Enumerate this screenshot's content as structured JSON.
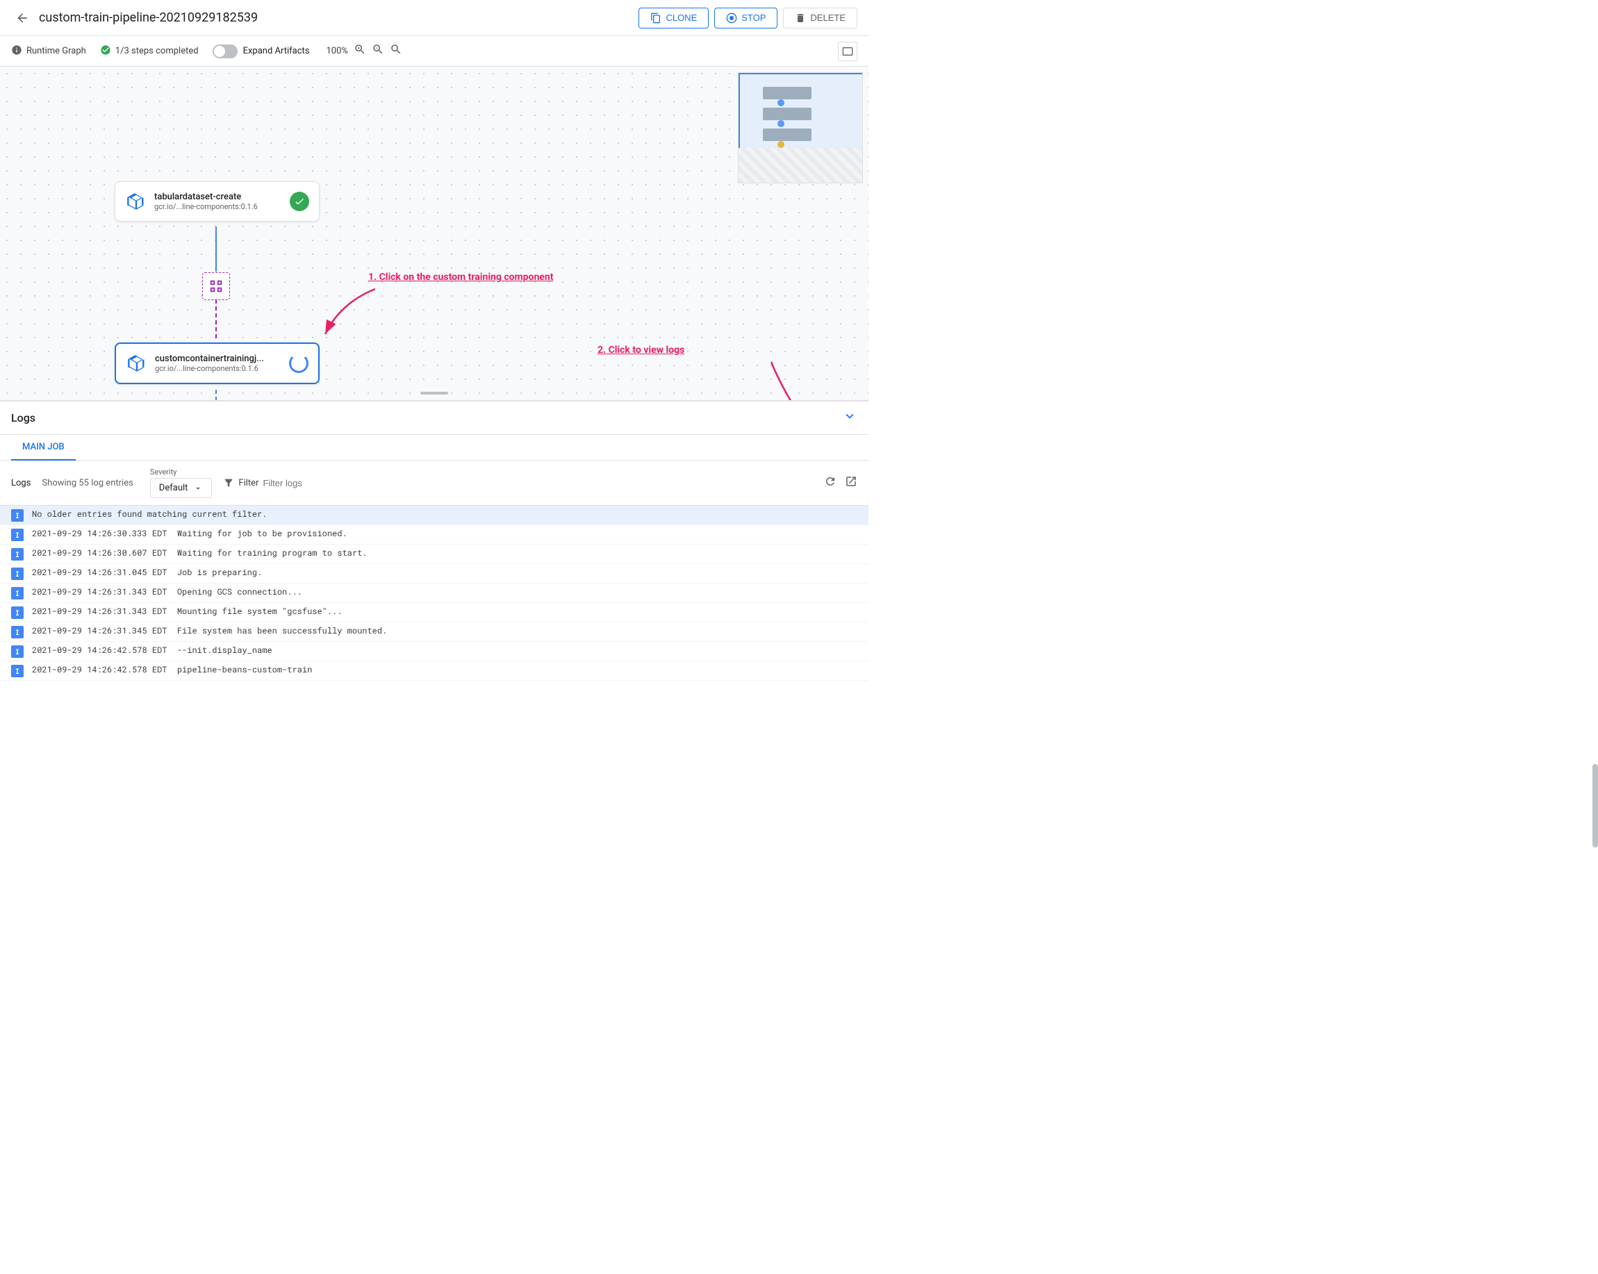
{
  "header": {
    "title": "custom-train-pipeline-20210929182539",
    "back_label": "Back",
    "clone_label": "CLONE",
    "stop_label": "STOP",
    "delete_label": "DELETE"
  },
  "toolbar": {
    "runtime_graph_label": "Runtime Graph",
    "steps_completed_label": "1/3 steps completed",
    "expand_artifacts_label": "Expand Artifacts",
    "zoom_level": "100%",
    "zoom_in_label": "+",
    "zoom_out_label": "-",
    "zoom_reset_label": "⌕"
  },
  "pipeline": {
    "node1": {
      "name": "tabulardataset-create",
      "subtitle": "gcr.io/...line-components:0.1.6",
      "status": "success"
    },
    "node2": {
      "name": "customcontainertrainingj...",
      "subtitle": "gcr.io/...line-components:0.1.6",
      "status": "running"
    }
  },
  "annotations": {
    "step1": "1. Click on the custom training component",
    "step2": "2. Click to view logs"
  },
  "logs": {
    "title": "Logs",
    "tab_main_job": "MAIN JOB",
    "label": "Logs",
    "count_label": "Showing 55 log entries",
    "severity_label": "Severity",
    "severity_value": "Default",
    "filter_label": "Filter",
    "filter_placeholder": "Filter logs",
    "entries": [
      {
        "type": "info-bg",
        "icon": "i",
        "text": "No older entries found matching current filter."
      },
      {
        "type": "white-bg",
        "icon": "i",
        "text": "2021-09-29 14:26:30.333 EDT  Waiting for job to be provisioned."
      },
      {
        "type": "white-bg",
        "icon": "i",
        "text": "2021-09-29 14:26:30.607 EDT  Waiting for training program to start."
      },
      {
        "type": "white-bg",
        "icon": "i",
        "text": "2021-09-29 14:26:31.045 EDT  Job is preparing."
      },
      {
        "type": "white-bg",
        "icon": "i",
        "text": "2021-09-29 14:26:31.343 EDT  Opening GCS connection..."
      },
      {
        "type": "white-bg",
        "icon": "i",
        "text": "2021-09-29 14:26:31.343 EDT  Mounting file system \"gcsfuse\"..."
      },
      {
        "type": "white-bg",
        "icon": "i",
        "text": "2021-09-29 14:26:31.345 EDT  File system has been successfully mounted."
      },
      {
        "type": "white-bg",
        "icon": "i",
        "text": "2021-09-29 14:26:42.578 EDT  --init.display_name"
      },
      {
        "type": "white-bg",
        "icon": "i",
        "text": "2021-09-29 14:26:42.578 EDT  pipeline-beans-custom-train"
      }
    ]
  }
}
